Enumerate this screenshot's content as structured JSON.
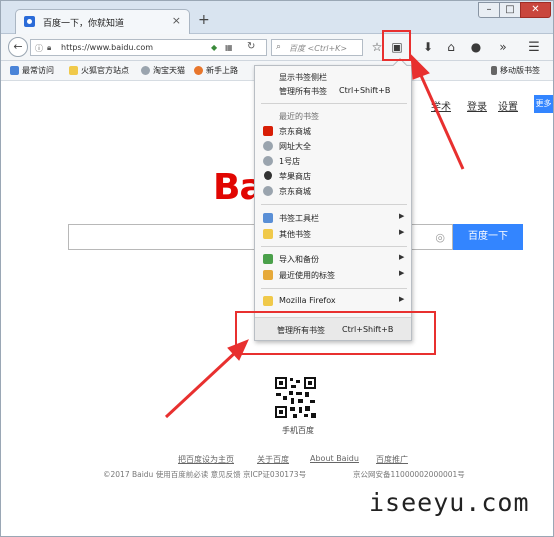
{
  "browser": {
    "tab_title": "百度一下，你就知道",
    "new_tab": "+",
    "window_controls": {
      "minimize": "–",
      "maximize": "□",
      "close": "✕"
    },
    "url": "https://www.baidu.com",
    "search_placeholder": "百度 <Ctrl+K>"
  },
  "bookmarks_bar": {
    "items": [
      "最常访问",
      "火狐官方站点",
      "淘宝天猫",
      "新手上路",
      "京东商城"
    ],
    "mobile": "移动版书签"
  },
  "page": {
    "top_links": [
      "学术",
      "登录",
      "设置"
    ],
    "more": "更多",
    "logo": "Bai",
    "search_button": "百度一下",
    "qr_label": "手机百度",
    "footer_links": [
      "把百度设为主页",
      "关于百度",
      "About Baidu",
      "百度推广"
    ],
    "footer_copyright": "©2017 Baidu 使用百度前必读 意见反馈 京ICP证030173号",
    "footer_police": "京公网安备11000002000001号"
  },
  "menu": {
    "show_sidebar": "显示书签侧栏",
    "manage_all": "管理所有书签",
    "manage_shortcut": "Ctrl+Shift+B",
    "recent_header": "最近的书签",
    "recent": [
      "京东商城",
      "网址大全",
      "1号店",
      "苹果商店",
      "京东商城"
    ],
    "toolbar": "书签工具栏",
    "other": "其他书签",
    "import_backup": "导入和备份",
    "recent_tags": "最近使用的标签",
    "mozilla": "Mozilla Firefox",
    "bottom_manage": "管理所有书签",
    "bottom_shortcut": "Ctrl+Shift+B"
  },
  "watermark": "iseeyu.com",
  "colors": {
    "highlight": "#e8302f",
    "baidu_blue": "#3385ff",
    "baidu_red": "#e10602"
  }
}
